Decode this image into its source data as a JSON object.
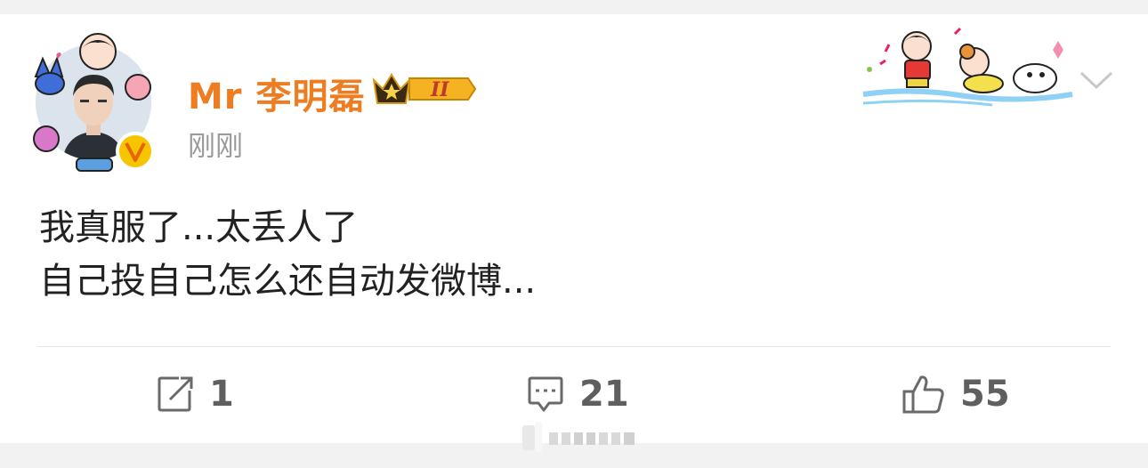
{
  "post": {
    "username": "Mr 李明磊",
    "timestamp": "刚刚",
    "content": "我真服了...太丢人了\n自己投自己怎么还自动发微博..."
  },
  "actions": {
    "repost_count": "1",
    "comment_count": "21",
    "like_count": "55"
  },
  "icons": {
    "repost": "repost-icon",
    "comment": "comment-icon",
    "like": "thumbs-up-icon",
    "dropdown": "chevron-down-icon",
    "vip": "crown-icon",
    "verified": "verified-v-icon"
  },
  "colors": {
    "username": "#ee7d22",
    "timestamp": "#9a9a9a",
    "content": "#222222",
    "actions": "#5f5f5f",
    "verified": "#f7c500"
  }
}
